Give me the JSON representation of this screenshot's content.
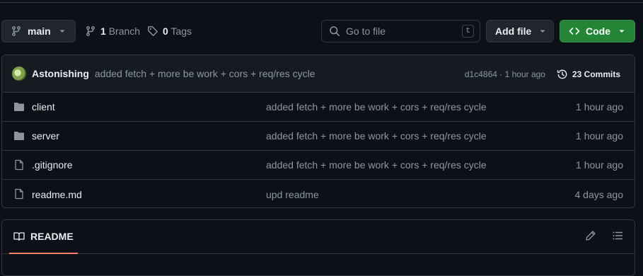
{
  "toolbar": {
    "branch_name": "main",
    "branches_count": "1",
    "branches_label": "Branch",
    "tags_count": "0",
    "tags_label": "Tags",
    "search_placeholder": "Go to file",
    "search_shortcut": "t",
    "add_file_label": "Add file",
    "code_label": "Code"
  },
  "commit": {
    "author": "Astonishing",
    "message": "added fetch + more be work + cors + req/res cycle",
    "sha_time": "d1c4864 · 1 hour ago",
    "commits_label": "23 Commits"
  },
  "files": [
    {
      "name": "client",
      "type": "folder",
      "message": "added fetch + more be work + cors + req/res cycle",
      "age": "1 hour ago"
    },
    {
      "name": "server",
      "type": "folder",
      "message": "added fetch + more be work + cors + req/res cycle",
      "age": "1 hour ago"
    },
    {
      "name": ".gitignore",
      "type": "file",
      "message": "added fetch + more be work + cors + req/res cycle",
      "age": "1 hour ago"
    },
    {
      "name": "readme.md",
      "type": "file",
      "message": "upd readme",
      "age": "4 days ago"
    }
  ],
  "readme": {
    "tab_label": "README"
  },
  "colors": {
    "background": "#0d1117",
    "border": "#30363d",
    "code_button": "#238636",
    "tab_underline": "#f78166"
  }
}
